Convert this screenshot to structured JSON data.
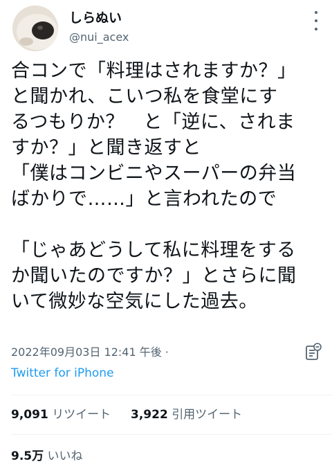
{
  "user": {
    "display_name": "しらぬい",
    "handle": "@nui_acex"
  },
  "tweet": {
    "lines": [
      "合コンで「料理はされますか？」",
      "と聞かれ、こいつ私を食堂にす",
      "るつもりか？　と「逆に、されま",
      "すか？」と聞き返すと",
      "「僕はコンビニやスーパーの弁当",
      "ばかりで……」と言われたので",
      "",
      "「じゃあどうして私に料理をする",
      "か聞いたのですか？」とさらに聞",
      "いて微妙な空気にした過去。"
    ]
  },
  "meta": {
    "timestamp": "2022年09月03日 12:41 午後 ·",
    "source": "Twitter for iPhone"
  },
  "stats": {
    "retweets_count": "9,091",
    "retweets_label": "リツイート",
    "quotes_count": "3,922",
    "quotes_label": "引用ツイート",
    "likes_count": "9.5万",
    "likes_label": "いいね"
  },
  "icons": {
    "more": "more-icon",
    "analytics": "analytics-icon"
  },
  "colors": {
    "text": "#0f1419",
    "secondary": "#536471",
    "link": "#1d9bf0",
    "divider": "#eff3f4"
  }
}
